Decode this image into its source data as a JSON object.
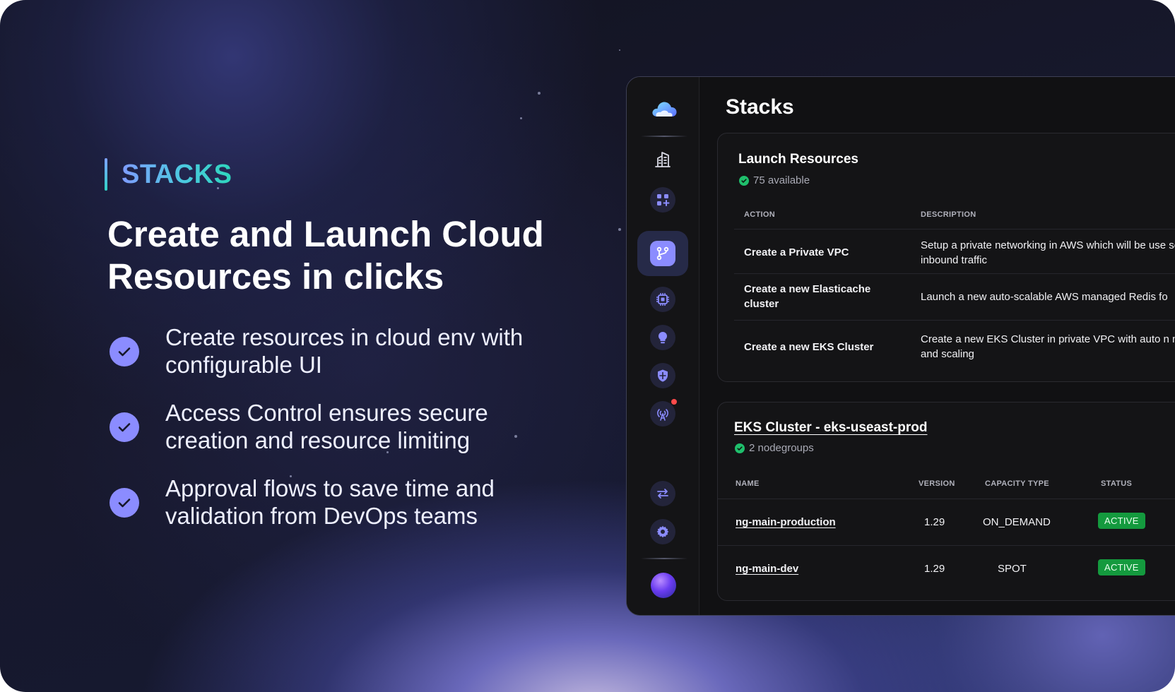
{
  "marketing": {
    "eyebrow": "STACKS",
    "headline": "Create and Launch Cloud Resources in clicks",
    "features": [
      "Create resources in cloud env with configurable UI",
      "Access Control ensures secure creation and resource limiting",
      "Approval flows to save time and validation from DevOps teams"
    ]
  },
  "sidebar": {
    "icons": [
      "cloud-logo-icon",
      "building-icon",
      "apps-add-icon",
      "stacks-branch-icon",
      "chip-icon",
      "lightbulb-icon",
      "shield-icon",
      "broadcast-icon",
      "swap-icon",
      "gear-icon"
    ],
    "active_item": "stacks-branch-icon"
  },
  "app": {
    "page_title": "Stacks",
    "launch": {
      "title": "Launch Resources",
      "available": "75 available",
      "columns": [
        "ACTION",
        "DESCRIPTION"
      ],
      "rows": [
        {
          "action": "Create a Private VPC",
          "description": "Setup a private networking in AWS which will be use secure inbound traffic"
        },
        {
          "action": "Create a new Elasticache cluster",
          "description": "Launch a new auto-scalable AWS managed Redis fo"
        },
        {
          "action": "Create a new EKS Cluster",
          "description": "Create a new EKS Cluster in private VPC with auto n management and scaling"
        }
      ]
    },
    "cluster": {
      "title": "EKS Cluster - eks-useast-prod",
      "nodegroups": "2 nodegroups",
      "columns": [
        "NAME",
        "VERSION",
        "CAPACITY TYPE",
        "STATUS"
      ],
      "rows": [
        {
          "name": "ng-main-production",
          "version": "1.29",
          "capacity": "ON_DEMAND",
          "status": "ACTIVE"
        },
        {
          "name": "ng-main-dev",
          "version": "1.29",
          "capacity": "SPOT",
          "status": "ACTIVE"
        }
      ]
    }
  },
  "colors": {
    "accent": "#8b8cff",
    "status_active": "#149a3e",
    "status_ok": "#1fbf6c"
  }
}
